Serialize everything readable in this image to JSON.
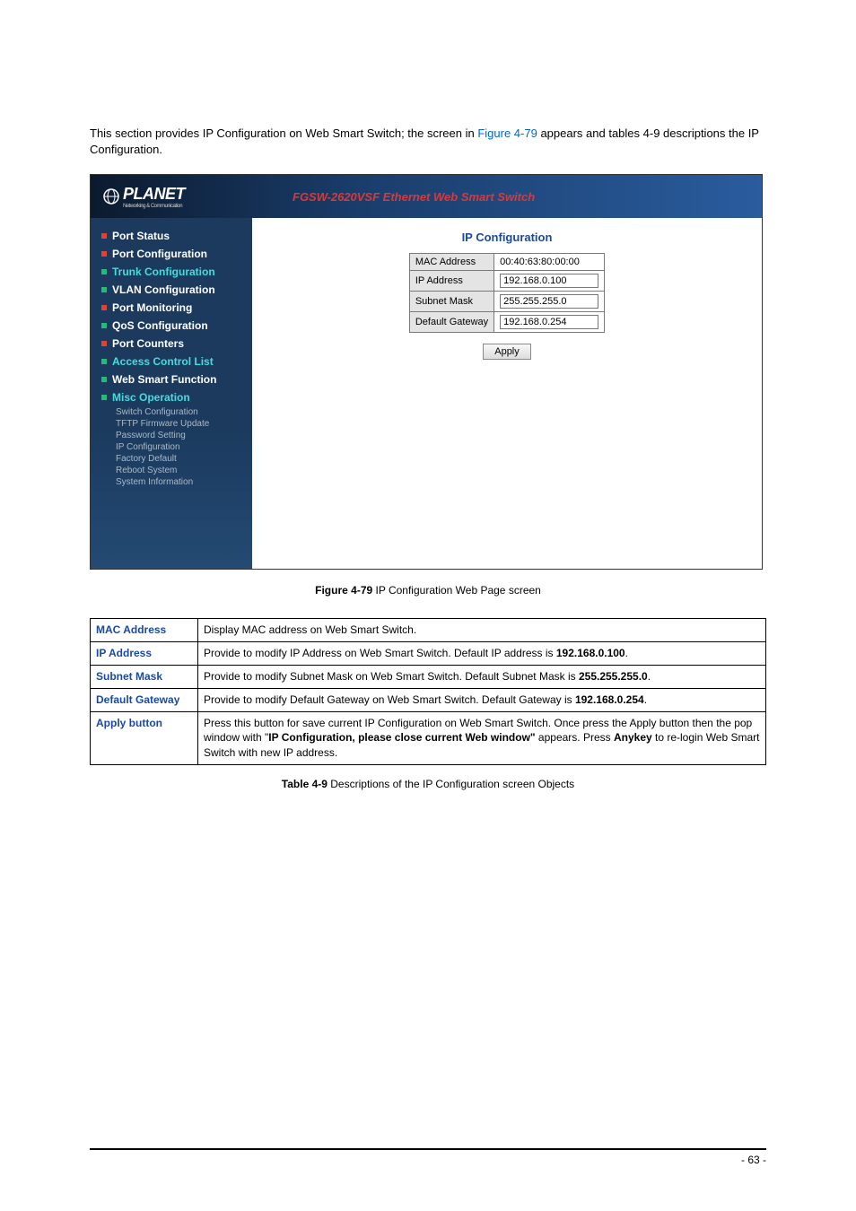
{
  "intro": {
    "p1": "This section provides IP Configuration on Web Smart Switch; the screen in ",
    "link": "Figure 4-79",
    "p2": " appears and tables 4-9 descriptions the IP Configuration."
  },
  "app": {
    "logo": "PLANET",
    "logo_sub": "Networking & Communication",
    "header_title": "FGSW-2620VSF Ethernet Web Smart Switch",
    "sidebar": [
      {
        "label": "Port Status",
        "classes": "nav-item"
      },
      {
        "label": "Port Configuration",
        "classes": "nav-item"
      },
      {
        "label": "Trunk Configuration",
        "classes": "nav-item alt teal"
      },
      {
        "label": "VLAN Configuration",
        "classes": "nav-item alt"
      },
      {
        "label": "Port Monitoring",
        "classes": "nav-item"
      },
      {
        "label": "QoS Configuration",
        "classes": "nav-item alt"
      },
      {
        "label": "Port Counters",
        "classes": "nav-item"
      },
      {
        "label": "Access Control List",
        "classes": "nav-item alt teal"
      },
      {
        "label": "Web Smart Function",
        "classes": "nav-item alt"
      },
      {
        "label": "Misc Operation",
        "classes": "nav-item alt teal"
      }
    ],
    "subitems": [
      "Switch Configuration",
      "TFTP Firmware Update",
      "Password Setting",
      "IP Configuration",
      "Factory Default",
      "Reboot System",
      "System Information"
    ],
    "panel_title": "IP Configuration",
    "form": {
      "mac_label": "MAC Address",
      "mac_value": "00:40:63:80:00:00",
      "ip_label": "IP Address",
      "ip_value": "192.168.0.100",
      "mask_label": "Subnet Mask",
      "mask_value": "255.255.255.0",
      "gw_label": "Default Gateway",
      "gw_value": "192.168.0.254",
      "apply": "Apply"
    }
  },
  "figure_caption_pre": "Figure 4-79 ",
  "figure_caption": "IP Configuration Web Page screen",
  "desc": {
    "rows": [
      {
        "obj": "MAC Address",
        "d1": "Display MAC address on Web Smart Switch.",
        "bold": "",
        "d2": ""
      },
      {
        "obj": "IP Address",
        "d1": "Provide to modify IP Address on Web Smart Switch. Default IP address is ",
        "bold": "192.168.0.100",
        "d2": "."
      },
      {
        "obj": "Subnet Mask",
        "d1": "Provide to modify Subnet Mask on Web Smart Switch. Default Subnet Mask is ",
        "bold": "255.255.255.0",
        "d2": "."
      },
      {
        "obj": "Default Gateway",
        "d1": "Provide to modify Default Gateway on Web Smart Switch. Default Gateway is ",
        "bold": "192.168.0.254",
        "d2": "."
      }
    ],
    "apply_obj": "Apply button",
    "apply_d1": "Press this button for save current IP Configuration on Web Smart Switch. Once press the Apply button then the pop window with \"",
    "apply_bold1": "IP Configuration, please close current Web window\"",
    "apply_d2": " appears. Press ",
    "apply_bold2": "Anykey",
    "apply_d3": " to re-login Web Smart Switch with new IP address."
  },
  "table_caption_pre": "Table 4-9 ",
  "table_caption": "Descriptions of the IP Configuration screen Objects",
  "page_num": "- 63 -"
}
